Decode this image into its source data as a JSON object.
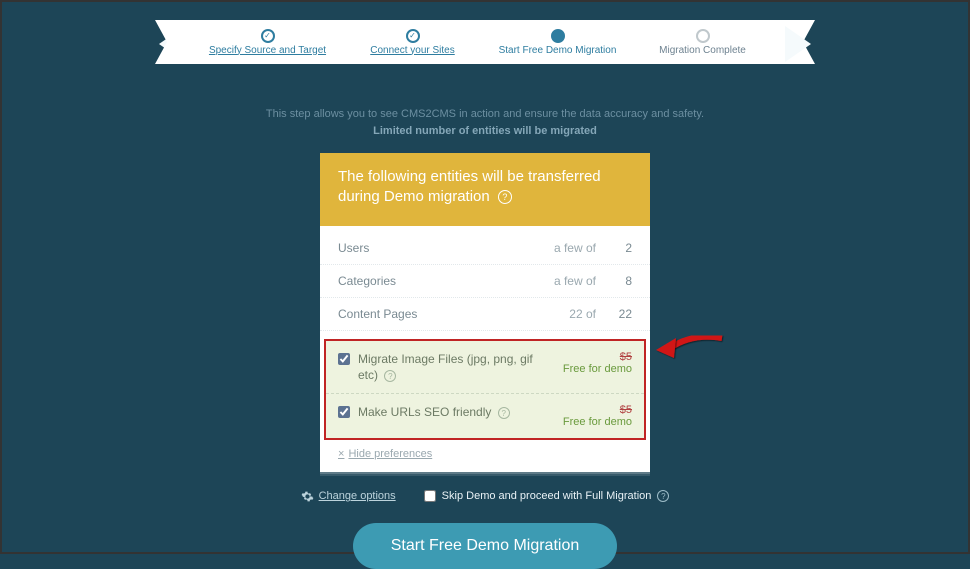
{
  "steps": [
    {
      "label": "Specify Source and Target"
    },
    {
      "label": "Connect your Sites"
    },
    {
      "label": "Start Free Demo Migration"
    },
    {
      "label": "Migration Complete"
    }
  ],
  "intro": {
    "line1": "This step allows you to see CMS2CMS in action and ensure the data accuracy and safety.",
    "line2": "Limited number of entities will be migrated"
  },
  "card": {
    "title": "The following entities will be transferred during Demo migration",
    "rows": [
      {
        "name": "Users",
        "mid": "a few of",
        "count": "2"
      },
      {
        "name": "Categories",
        "mid": "a few of",
        "count": "8"
      },
      {
        "name": "Content Pages",
        "mid": "22 of",
        "count": "22"
      }
    ],
    "options": [
      {
        "label": "Migrate Image Files (jpg, png, gif etc)",
        "strike": "$5",
        "free": "Free for demo"
      },
      {
        "label": "Make URLs SEO friendly",
        "strike": "$5",
        "free": "Free for demo"
      }
    ],
    "hide_pref": "Hide preferences"
  },
  "below": {
    "change": "Change options",
    "skip": "Skip Demo and proceed with Full Migration"
  },
  "cta": "Start Free Demo Migration"
}
